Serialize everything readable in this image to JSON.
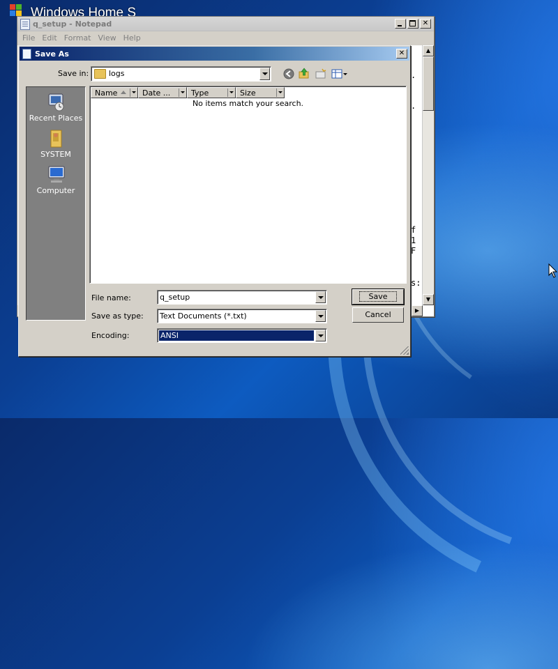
{
  "desktop": {
    "partial_title": "Windows Home S"
  },
  "notepad": {
    "title": "q_setup - Notepad",
    "menu": [
      "File",
      "Edit",
      "Format",
      "View",
      "Help"
    ],
    "visible_text_lines": [
      ".",
      ".",
      "f",
      "1",
      "F",
      "s:"
    ]
  },
  "dialog": {
    "title": "Save As",
    "save_in_label": "Save in:",
    "save_in_value": "logs",
    "places": [
      "Recent Places",
      "SYSTEM",
      "Computer"
    ],
    "columns": [
      "Name",
      "Date ...",
      "Type",
      "Size"
    ],
    "empty_message": "No items match your search.",
    "file_name_label": "File name:",
    "file_name_value": "q_setup",
    "save_as_type_label": "Save as type:",
    "save_as_type_value": "Text Documents (*.txt)",
    "encoding_label": "Encoding:",
    "encoding_value": "ANSI",
    "save_button": "Save",
    "cancel_button": "Cancel"
  },
  "icons": [
    "back-icon",
    "up-folder-icon",
    "new-folder-icon",
    "view-menu-icon",
    "folder-icon",
    "recent-places-icon",
    "user-folder-icon",
    "computer-icon",
    "mouse-cursor-icon"
  ],
  "colors": {
    "title_active": "#0a246a",
    "dialog_face": "#d4d0c8",
    "places_bar": "#808080"
  }
}
